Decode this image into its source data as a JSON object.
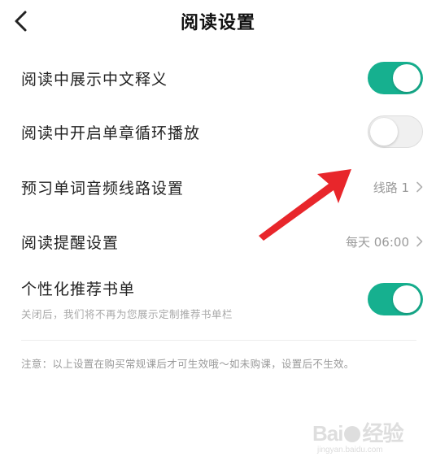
{
  "header": {
    "title": "阅读设置",
    "back_icon": "chevron-left-icon"
  },
  "settings": [
    {
      "label": "阅读中展示中文释义",
      "type": "toggle",
      "on": true
    },
    {
      "label": "阅读中开启单章循环播放",
      "type": "toggle",
      "on": false
    },
    {
      "label": "预习单词音频线路设置",
      "type": "link",
      "value": "线路 1",
      "icon": "chevron-right-icon"
    },
    {
      "label": "阅读提醒设置",
      "type": "link",
      "value": "每天 06:00",
      "icon": "chevron-right-icon"
    },
    {
      "label": "个性化推荐书单",
      "type": "toggle",
      "on": true,
      "description": "关闭后，我们将不再为您展示定制推荐书单栏"
    }
  ],
  "note": "注意：以上设置在购买常规课后才可生效哦～如未购课，设置后不生效。",
  "colors": {
    "toggle_on": "#16b08f",
    "toggle_off": "#f0f0f0",
    "annotation_arrow": "#e8262b"
  },
  "watermark": {
    "logo_text": "Bai 经验",
    "url": "jingyan.baidu.com"
  }
}
